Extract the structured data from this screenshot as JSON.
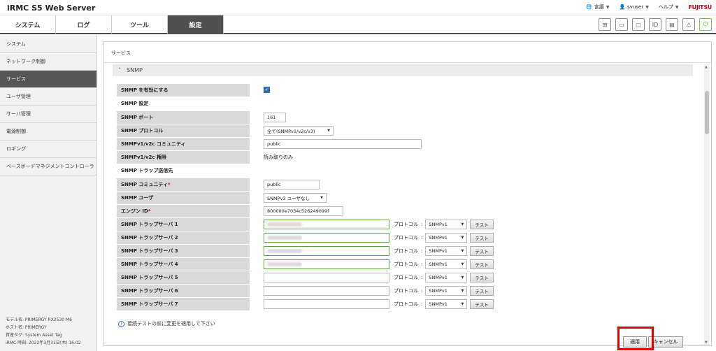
{
  "app": {
    "title": "iRMC S5 Web Server",
    "language_label": "言語",
    "user_label": "svuser",
    "help_label": "ヘルプ",
    "brand": "FUJITSU"
  },
  "tabs": [
    {
      "label": "システム"
    },
    {
      "label": "ログ"
    },
    {
      "label": "ツール"
    },
    {
      "label": "設定",
      "active": true
    }
  ],
  "sidebar": {
    "items": [
      {
        "label": "システム"
      },
      {
        "label": "ネットワーク制御"
      },
      {
        "label": "サービス",
        "active": true
      },
      {
        "label": "ユーザ管理"
      },
      {
        "label": "サーバ管理"
      },
      {
        "label": "電源制御"
      },
      {
        "label": "ロギング"
      },
      {
        "label": "ベースボードマネジメントコントローラ"
      }
    ],
    "sysinfo": {
      "model": "モデル名: PRIMERGY RX2530 M6",
      "host": "ホスト名: PRIMERGY",
      "asset": "資産タグ: System Asset Tag",
      "time": "iRMC 時刻: 2022年3月31日(木) 16:02"
    }
  },
  "main": {
    "title": "サービス",
    "section_title": "SNMP",
    "enable_label": "SNMP を有効にする",
    "enable_checked": true,
    "settings_heading": "SNMP 設定",
    "port_label": "SNMP ポート",
    "port_value": "161",
    "protocol_label": "SNMP プロトコル",
    "protocol_value": "全て(SNMPv1/v2c/v3)",
    "community_label": "SNMPv1/v2c コミュニティ",
    "community_value": "public",
    "permission_label": "SNMPv1/v2c 権限",
    "permission_value": "読み取りのみ",
    "trap_heading": "SNMP トラップ送信先",
    "trap_community_label": "SNMP コミュニティ",
    "trap_community_value": "public",
    "trap_user_label": "SNMP ユーザ",
    "trap_user_value": "SNMPv3 ユーザなし",
    "engine_label": "エンジン ID",
    "engine_value": "800000e7034c526249099f",
    "trap_servers": [
      {
        "label": "SNMP トラップサーバ 1",
        "value": "",
        "filled": true,
        "protocol_label": "プロトコル",
        "protocol": "SNMPv1",
        "test": "テスト"
      },
      {
        "label": "SNMP トラップサーバ 2",
        "value": "",
        "filled": true,
        "protocol_label": "プロトコル",
        "protocol": "SNMPv1",
        "test": "テスト"
      },
      {
        "label": "SNMP トラップサーバ 3",
        "value": "",
        "filled": true,
        "protocol_label": "プロトコル",
        "protocol": "SNMPv1",
        "test": "テスト"
      },
      {
        "label": "SNMP トラップサーバ 4",
        "value": "",
        "filled": true,
        "protocol_label": "プロトコル",
        "protocol": "SNMPv1",
        "test": "テスト"
      },
      {
        "label": "SNMP トラップサーバ 5",
        "value": "",
        "filled": false,
        "protocol_label": "プロトコル",
        "protocol": "SNMPv1",
        "test": "テスト"
      },
      {
        "label": "SNMP トラップサーバ 6",
        "value": "",
        "filled": false,
        "protocol_label": "プロトコル",
        "protocol": "SNMPv1",
        "test": "テスト"
      },
      {
        "label": "SNMP トラップサーバ 7",
        "value": "",
        "filled": false,
        "protocol_label": "プロトコル",
        "protocol": "SNMPv1",
        "test": "テスト"
      }
    ],
    "info_text": "接続テストの前に変更を適用して下さい",
    "apply_label": "適用",
    "cancel_label": "キャンセル"
  },
  "colors": {
    "active_tab": "#505050",
    "highlight": "#e00000",
    "filled_border": "#5aa83c",
    "brand_red": "#d0021b"
  }
}
